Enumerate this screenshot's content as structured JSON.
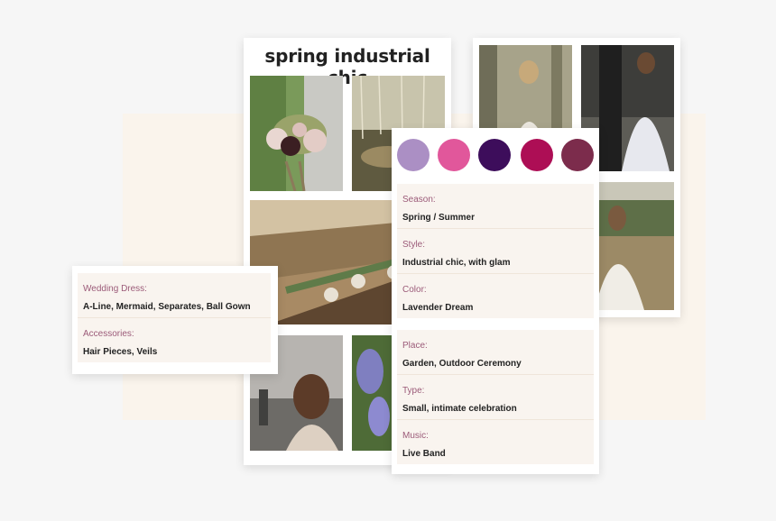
{
  "moodboard": {
    "title": "spring industrial chic"
  },
  "palette": {
    "colors": [
      "#ab8fc4",
      "#e1579b",
      "#3d0d5b",
      "#ad0e55",
      "#7c2c4c"
    ]
  },
  "details_top": [
    {
      "label": "Season:",
      "value": "Spring / Summer"
    },
    {
      "label": "Style:",
      "value": "Industrial chic, with glam"
    },
    {
      "label": "Color:",
      "value": "Lavender Dream"
    }
  ],
  "details_bottom": [
    {
      "label": "Place:",
      "value": "Garden, Outdoor Ceremony"
    },
    {
      "label": "Type:",
      "value": "Small, intimate celebration"
    },
    {
      "label": "Music:",
      "value": "Live Band"
    }
  ],
  "dress": [
    {
      "label": "Wedding Dress:",
      "value": "A-Line, Mermaid, Separates, Ball Gown"
    },
    {
      "label": "Accessories:",
      "value": "Hair Pieces, Veils"
    }
  ]
}
